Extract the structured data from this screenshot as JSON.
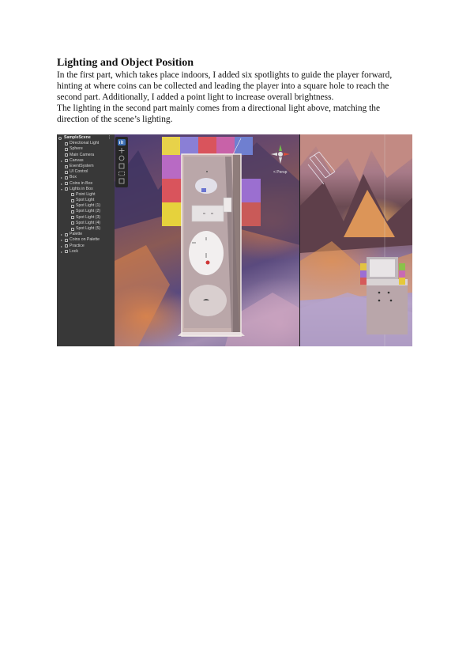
{
  "document": {
    "title": "Lighting and Object Position",
    "paragraphs": [
      "In the first part, which takes place indoors, I added six spotlights to guide the player forward, hinting at where coins can be collected and leading the player into a square hole to reach the second part. Additionally, I added a point light to increase overall brightness.",
      "The lighting in the second part mainly comes from a directional light above, matching the direction of the scene’s lighting."
    ]
  },
  "screenshot": {
    "hierarchy": {
      "scene_name": "SampleScene",
      "menu_icon": "kebab-icon",
      "items": [
        {
          "label": "Directional Light",
          "depth": 1,
          "expandable": false
        },
        {
          "label": "Sphere",
          "depth": 1,
          "expandable": false
        },
        {
          "label": "Main Camera",
          "depth": 1,
          "expandable": false
        },
        {
          "label": "Canvas",
          "depth": 1,
          "expandable": true
        },
        {
          "label": "EventSystem",
          "depth": 1,
          "expandable": false
        },
        {
          "label": "UI Control",
          "depth": 1,
          "expandable": false
        },
        {
          "label": "Box",
          "depth": 1,
          "expandable": true
        },
        {
          "label": "Coins in Box",
          "depth": 1,
          "expandable": true
        },
        {
          "label": "Lights in Box",
          "depth": 1,
          "expandable": true,
          "expanded": true
        },
        {
          "label": "Point Light",
          "depth": 2,
          "expandable": false
        },
        {
          "label": "Spot Light",
          "depth": 2,
          "expandable": false
        },
        {
          "label": "Spot Light (1)",
          "depth": 2,
          "expandable": false
        },
        {
          "label": "Spot Light (2)",
          "depth": 2,
          "expandable": false
        },
        {
          "label": "Spot Light (3)",
          "depth": 2,
          "expandable": false
        },
        {
          "label": "Spot Light (4)",
          "depth": 2,
          "expandable": false
        },
        {
          "label": "Spot Light (5)",
          "depth": 2,
          "expandable": false
        },
        {
          "label": "Palette",
          "depth": 1,
          "expandable": true
        },
        {
          "label": "Coins on Palette",
          "depth": 1,
          "expandable": true
        },
        {
          "label": "Practice",
          "depth": 1,
          "expandable": true
        },
        {
          "label": "Lock",
          "depth": 1,
          "expandable": true
        }
      ]
    },
    "scene_view": {
      "gizmo_label": "< Persp",
      "tools": [
        "hand-tool-icon",
        "move-tool-icon",
        "rotate-tool-icon",
        "scale-tool-icon",
        "rect-tool-icon",
        "transform-tool-icon"
      ],
      "tile_colors": [
        "#e7d24a",
        "#8a7fd6",
        "#d9545c",
        "#c862a8",
        "#6f7fd0",
        "#b86ac4",
        "#d9545c",
        "#e6d23c",
        "#9b6fd0",
        "#c95a58"
      ]
    },
    "game_view": {
      "tile_colors": [
        "#e2c341",
        "#9c6ed4",
        "#d55a5a",
        "#8ac24a",
        "#c86ab4",
        "#e5c83a"
      ]
    }
  }
}
